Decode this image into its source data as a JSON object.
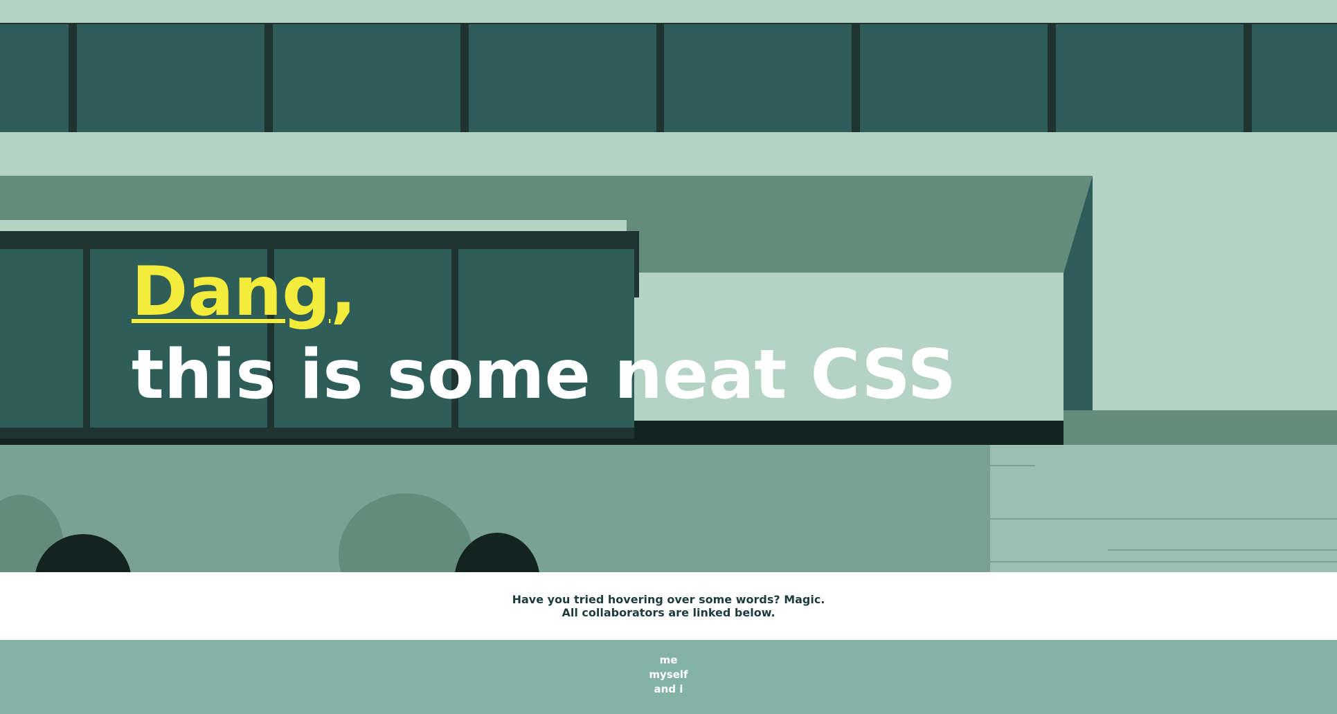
{
  "headline": {
    "accent_word": "Dang",
    "accent_punct": ",",
    "words": [
      "this",
      "is",
      "some",
      "neat",
      "CSS"
    ]
  },
  "hint": {
    "line1": "Have you tried hovering over some words? Magic.",
    "line2": "All collaborators are linked below."
  },
  "footer": {
    "links": [
      "me",
      "myself",
      "and i"
    ]
  },
  "colors": {
    "sky_light": "#b4d3c5",
    "canopy_dark": "#2e5d59",
    "band_mid": "#648c7c",
    "train_body": "#2f5d58",
    "train_roof": "#1f3330",
    "ground": "#79a295",
    "accent_yellow": "#f3ec3a",
    "footer_bg": "#85b2a7",
    "text_dark": "#1d3b3d"
  }
}
